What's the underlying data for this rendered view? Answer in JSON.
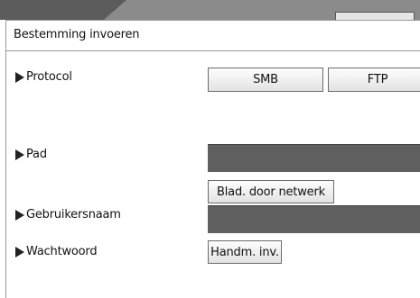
{
  "title": "Bestemming invoeren",
  "protocol": {
    "label": "Protocol",
    "options": [
      "SMB",
      "FTP"
    ]
  },
  "path": {
    "label": "Pad",
    "value": "",
    "browse_button": "Blad. door netwerk"
  },
  "username": {
    "label": "Gebruikersnaam",
    "value": ""
  },
  "password": {
    "label": "Wachtwoord",
    "manual_input_button": "Handm. inv."
  },
  "colors": {
    "topbar": "#8b8b8b",
    "field_fill": "#5f5f5f",
    "button_border": "#6b6b6b"
  }
}
